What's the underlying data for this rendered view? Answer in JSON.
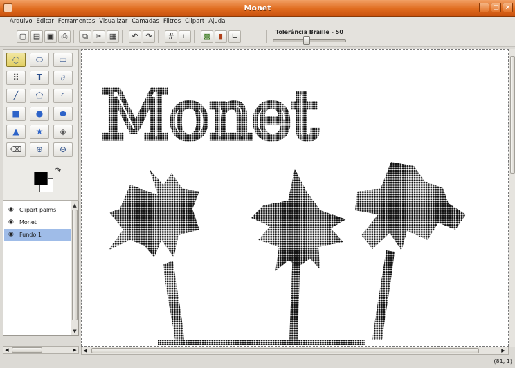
{
  "window": {
    "title": "Monet"
  },
  "menu": [
    "Arquivo",
    "Editar",
    "Ferramentas",
    "Visualizar",
    "Camadas",
    "Filtros",
    "Clipart",
    "Ajuda"
  ],
  "toolbar": {
    "buttons": [
      "new-file-icon",
      "open-icon",
      "save-icon",
      "print-icon",
      "copy-icon",
      "cut-icon",
      "paste-icon",
      "undo-icon",
      "redo-icon",
      "grid-icon",
      "crop-icon",
      "image-icon",
      "chart-icon",
      "graph-icon"
    ],
    "braille_tolerance_label": "Tolerância Braille - 50",
    "braille_tolerance_value": 50
  },
  "tools": [
    "lasso-icon",
    "ellipse-select-icon",
    "rect-select-icon",
    "braille-dots-icon",
    "text-icon",
    "freehand-icon",
    "line-icon",
    "polygon-icon",
    "arc-icon",
    "rectangle-icon",
    "circle-icon",
    "ellipse-icon",
    "triangle-icon",
    "star-icon",
    "fill-icon",
    "eraser-icon",
    "zoom-in-icon",
    "zoom-out-icon"
  ],
  "colors": {
    "foreground": "#000000",
    "background": "#ffffff",
    "titlebar": "#e06c1f",
    "selected_layer": "#9fbce8"
  },
  "layers": [
    {
      "name": "Clipart palms"
    },
    {
      "name": "Monet"
    },
    {
      "name": "Fundo 1",
      "selected": true
    }
  ],
  "canvas": {
    "text": "Monet"
  },
  "status": {
    "coords": "(81, 1)"
  }
}
